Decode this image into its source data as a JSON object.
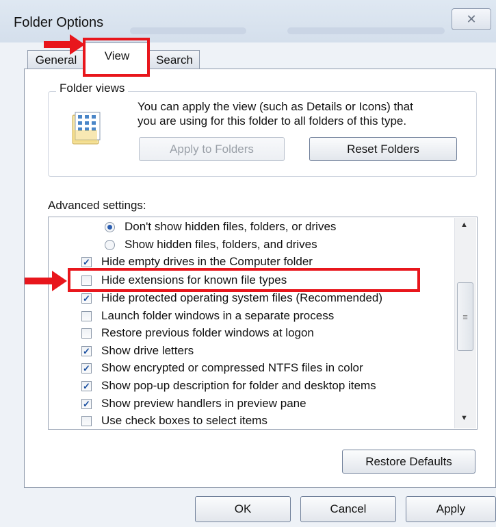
{
  "window": {
    "title": "Folder Options",
    "close_glyph": "✕"
  },
  "tabs": [
    {
      "label": "General"
    },
    {
      "label": "View",
      "active": true
    },
    {
      "label": "Search"
    }
  ],
  "folder_views": {
    "label": "Folder views",
    "description_line1": "You can apply the view (such as Details or Icons) that",
    "description_line2": "you are using for this folder to all folders of this type.",
    "apply_button": "Apply to Folders",
    "reset_button": "Reset Folders",
    "icon": "folder-view-icon"
  },
  "advanced": {
    "label": "Advanced settings:",
    "items": [
      {
        "type": "radio",
        "checked": true,
        "label": "Don't show hidden files, folders, or drives"
      },
      {
        "type": "radio",
        "checked": false,
        "label": "Show hidden files, folders, and drives"
      },
      {
        "type": "checkbox",
        "checked": true,
        "label": "Hide empty drives in the Computer folder"
      },
      {
        "type": "checkbox",
        "checked": false,
        "label": "Hide extensions for known file types"
      },
      {
        "type": "checkbox",
        "checked": true,
        "label": "Hide protected operating system files (Recommended)"
      },
      {
        "type": "checkbox",
        "checked": false,
        "label": "Launch folder windows in a separate process"
      },
      {
        "type": "checkbox",
        "checked": false,
        "label": "Restore previous folder windows at logon"
      },
      {
        "type": "checkbox",
        "checked": true,
        "label": "Show drive letters"
      },
      {
        "type": "checkbox",
        "checked": true,
        "label": "Show encrypted or compressed NTFS files in color"
      },
      {
        "type": "checkbox",
        "checked": true,
        "label": "Show pop-up description for folder and desktop items"
      },
      {
        "type": "checkbox",
        "checked": true,
        "label": "Show preview handlers in preview pane"
      },
      {
        "type": "checkbox",
        "checked": false,
        "label": "Use check boxes to select items"
      }
    ],
    "restore_button": "Restore Defaults"
  },
  "footer": {
    "ok": "OK",
    "cancel": "Cancel",
    "apply": "Apply"
  },
  "annotations": {
    "color": "#e8161c",
    "arrow_glyph": "➜"
  },
  "glyphs": {
    "check": "✓",
    "scroll_up": "▲",
    "scroll_down": "▼",
    "grip": "≡"
  }
}
